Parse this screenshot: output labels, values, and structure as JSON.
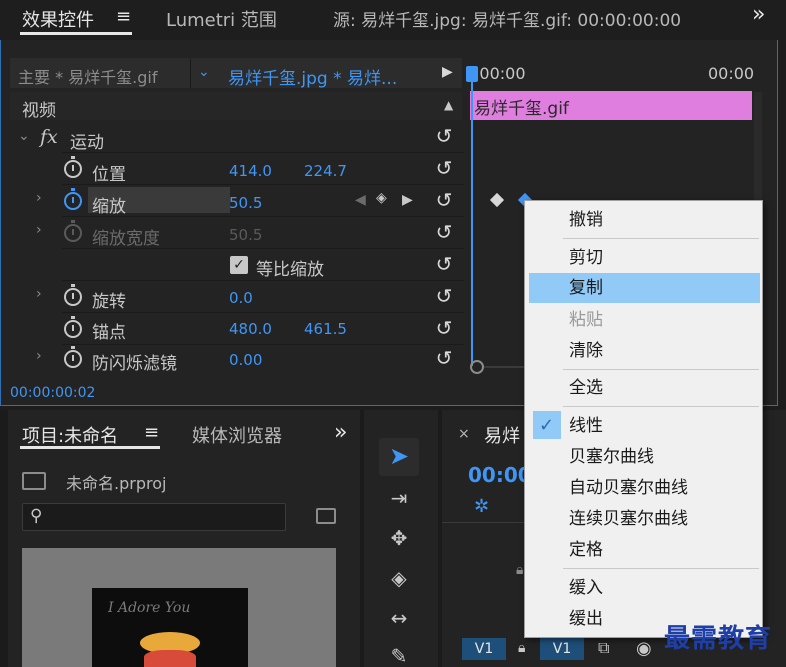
{
  "tabs": {
    "effect_controls": "效果控件",
    "lumetri": "Lumetri 范围",
    "source": "源: 易烊千玺.jpg: 易烊千玺.gif: 00:00:00:00",
    "menu_glyph": "≡",
    "more_glyph": "»"
  },
  "effect_controls": {
    "master_clip": "主要 * 易烊千玺.gif",
    "sequence_clip": "易烊千玺.jpg * 易烊...",
    "section_video": "视频",
    "fx_label": "fx",
    "motion_label": "运动",
    "properties": [
      {
        "name": "位置",
        "v1": "414.0",
        "v2": "224.7"
      },
      {
        "name": "缩放",
        "v1": "50.5",
        "v2": ""
      },
      {
        "name": "缩放宽度",
        "v1": "50.5",
        "v2": ""
      },
      {
        "name": "等比缩放",
        "v1": "",
        "v2": ""
      },
      {
        "name": "旋转",
        "v1": "0.0",
        "v2": ""
      },
      {
        "name": "锚点",
        "v1": "480.0",
        "v2": "461.5"
      },
      {
        "name": "防闪烁滤镜",
        "v1": "0.00",
        "v2": ""
      }
    ],
    "uniform_scale_checked": true,
    "timecode": "00:00:00:02"
  },
  "mini_timeline": {
    "start_time": ":00:00",
    "end_time": "00:00",
    "clip_name": "易烊千玺.gif",
    "clip_color": "#e07ee0"
  },
  "context_menu": {
    "items": [
      {
        "label": "撤销",
        "enabled": true
      },
      {
        "label": "剪切",
        "enabled": true
      },
      {
        "label": "复制",
        "enabled": true,
        "highlighted": true
      },
      {
        "label": "粘贴",
        "enabled": false
      },
      {
        "label": "清除",
        "enabled": true
      },
      {
        "label": "全选",
        "enabled": true
      },
      {
        "label": "线性",
        "enabled": true,
        "checked": true
      },
      {
        "label": "贝塞尔曲线",
        "enabled": true
      },
      {
        "label": "自动贝塞尔曲线",
        "enabled": true
      },
      {
        "label": "连续贝塞尔曲线",
        "enabled": true
      },
      {
        "label": "定格",
        "enabled": true
      },
      {
        "label": "缓入",
        "enabled": true
      },
      {
        "label": "缓出",
        "enabled": true
      }
    ]
  },
  "project": {
    "tab_label": "项目:未命名",
    "media_browser": "媒体浏览器",
    "file_name": "未命名.prproj",
    "thumb_text": "I Adore You"
  },
  "sequence": {
    "tab_prefix": "易烊",
    "timecode": "00:00",
    "track_v1": "V1",
    "track_v1_b": "V1"
  },
  "watermark": "最需教育"
}
